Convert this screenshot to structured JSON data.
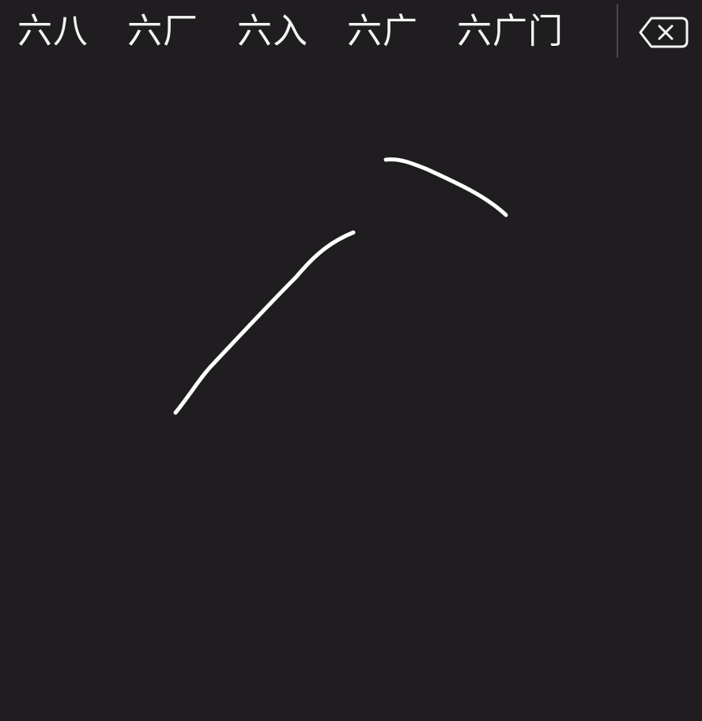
{
  "candidates": [
    "六八",
    "六厂",
    "六入",
    "六广",
    "六广门"
  ],
  "delete_icon": "backspace-icon",
  "colors": {
    "background": "#1f1d20",
    "text": "#f4f4f4",
    "ink": "#ffffff",
    "divider": "#4a484c"
  }
}
